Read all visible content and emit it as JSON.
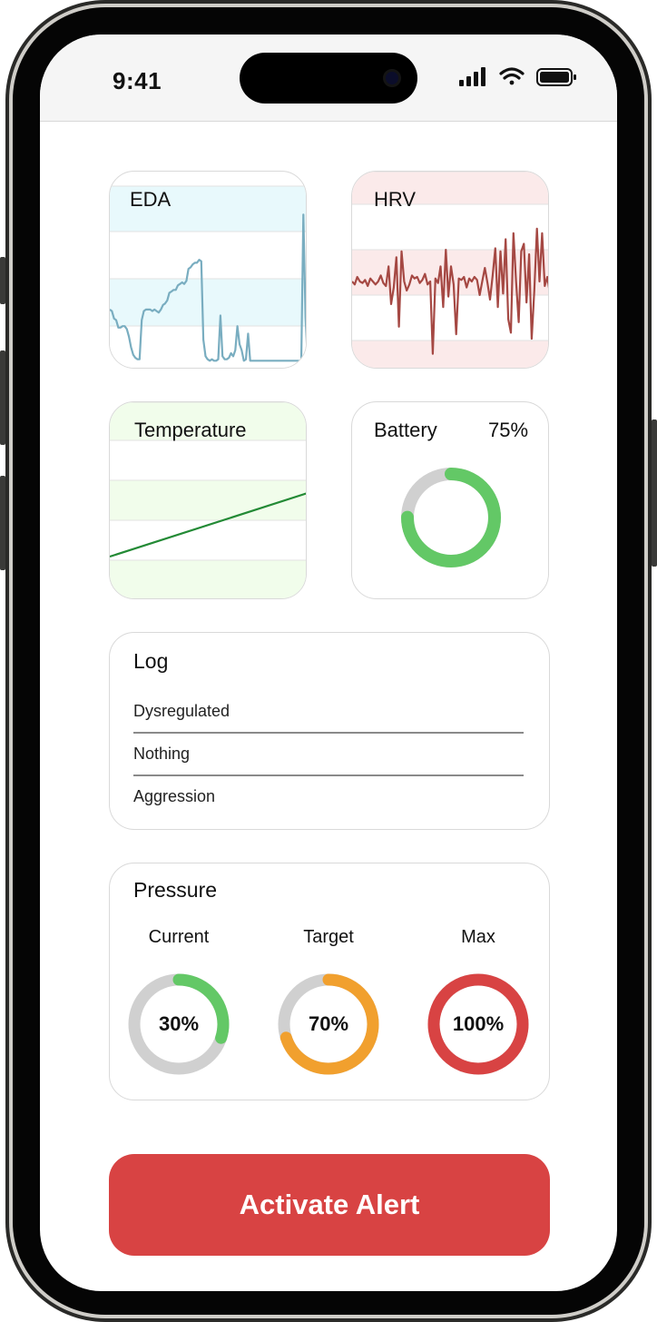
{
  "status_bar": {
    "time": "9:41",
    "icons": [
      "signal-bars-icon",
      "wifi-icon",
      "battery-full-icon"
    ]
  },
  "eda": {
    "title": "EDA",
    "color": "#79adc0",
    "band_color": "#e8f9fc",
    "values": [
      0.35,
      0.34,
      0.29,
      0.28,
      0.23,
      0.23,
      0.24,
      0.24,
      0.22,
      0.17,
      0.1,
      0.05,
      0.03,
      0.02,
      0.02,
      0.28,
      0.34,
      0.35,
      0.35,
      0.35,
      0.34,
      0.35,
      0.34,
      0.33,
      0.35,
      0.38,
      0.39,
      0.41,
      0.46,
      0.47,
      0.48,
      0.48,
      0.51,
      0.52,
      0.53,
      0.52,
      0.54,
      0.62,
      0.63,
      0.65,
      0.66,
      0.66,
      0.68,
      0.67,
      0.15,
      0.04,
      0.02,
      0.01,
      0.02,
      0.01,
      0.01,
      0.02,
      0.31,
      0.04,
      0.02,
      0.02,
      0.03,
      0.06,
      0.04,
      0.08,
      0.24,
      0.12,
      0.08,
      0.01,
      0.02,
      0.19,
      0.01,
      0.01,
      0.01,
      0.01,
      0.01,
      0.01,
      0.01,
      0.01,
      0.01,
      0.01,
      0.01,
      0.01,
      0.01,
      0.01,
      0.01,
      0.01,
      0.01,
      0.01,
      0.01,
      0.01,
      0.01,
      0.01,
      0.01,
      0.01,
      0.01,
      0.98,
      0.3,
      0.01
    ]
  },
  "hrv": {
    "title": "HRV",
    "color": "#a54843",
    "band_color": "#fbeaea",
    "values": [
      0.5,
      0.48,
      0.53,
      0.5,
      0.49,
      0.51,
      0.47,
      0.52,
      0.5,
      0.48,
      0.5,
      0.54,
      0.49,
      0.47,
      0.6,
      0.35,
      0.46,
      0.66,
      0.2,
      0.7,
      0.5,
      0.44,
      0.48,
      0.54,
      0.52,
      0.53,
      0.49,
      0.51,
      0.55,
      0.48,
      0.5,
      0.02,
      0.52,
      0.49,
      0.6,
      0.33,
      0.71,
      0.4,
      0.6,
      0.48,
      0.15,
      0.52,
      0.51,
      0.53,
      0.46,
      0.52,
      0.5,
      0.53,
      0.51,
      0.41,
      0.5,
      0.59,
      0.49,
      0.38,
      0.54,
      0.72,
      0.33,
      0.7,
      0.42,
      0.78,
      0.25,
      0.16,
      0.82,
      0.5,
      0.23,
      0.7,
      0.75,
      0.36,
      0.68,
      0.12,
      0.44,
      0.85,
      0.5,
      0.82,
      0.47,
      0.53,
      0.42
    ]
  },
  "temperature": {
    "title": "Temperature",
    "color": "#238a35",
    "band_color": "#f1fdeb",
    "values": [
      0.2,
      0.55
    ]
  },
  "battery": {
    "title": "Battery",
    "percent_label": "75%",
    "level": 0.75,
    "fill_color": "#63c866",
    "track_color": "#d0d0d0"
  },
  "log": {
    "title": "Log",
    "items": [
      "Dysregulated",
      "Nothing",
      "Aggression"
    ]
  },
  "pressure": {
    "title": "Pressure",
    "track_color": "#d0d0d0",
    "gauges": [
      {
        "label": "Current",
        "value_label": "30%",
        "value": 0.3,
        "color": "#63c866"
      },
      {
        "label": "Target",
        "value_label": "70%",
        "value": 0.7,
        "color": "#f1a02e"
      },
      {
        "label": "Max",
        "value_label": "100%",
        "value": 1.0,
        "color": "#d84343"
      }
    ]
  },
  "alert_button": {
    "label": "Activate Alert",
    "color": "#d84343"
  }
}
